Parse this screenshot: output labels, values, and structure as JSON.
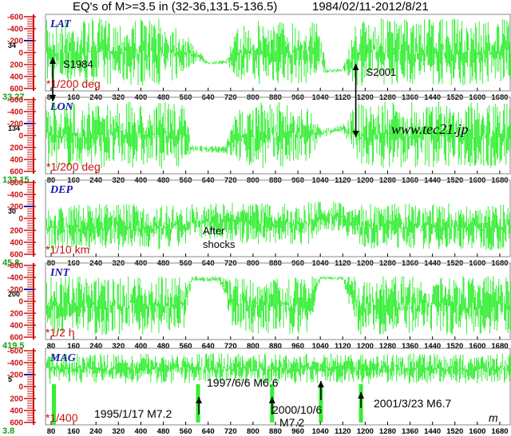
{
  "title": {
    "text": "EQ's of M>=3.5 in (32-36,131.5-136.5)",
    "date_range": "1984/02/11-2012/8/21"
  },
  "watermark": "www.tec21.jp",
  "colors": {
    "series": "#33ee33",
    "axis": "#cc1111",
    "zero_ref": "#1a1aa6",
    "text": "#000000",
    "offset_label": "#16a016"
  },
  "chart_data": {
    "type": "line",
    "x_axis": {
      "range": [
        60,
        1720
      ],
      "ticks": [
        80,
        160,
        240,
        320,
        400,
        480,
        560,
        640,
        720,
        800,
        880,
        960,
        1040,
        1120,
        1200,
        1280,
        1360,
        1440,
        1520,
        1600,
        1680
      ],
      "tick_labels": [
        "80",
        "160",
        "240",
        "320",
        "400",
        "480",
        "560",
        "640",
        "720",
        "800",
        "880",
        "960",
        "1040",
        "1120",
        "1200",
        "1280",
        "1360",
        "1440",
        "1520",
        "1600",
        "1680"
      ],
      "unit": "m"
    },
    "grid": false,
    "panels": [
      {
        "name": "LAT",
        "scale": "*1/200 deg",
        "ref_value": "34",
        "offset_value": "33.27",
        "ylim": [
          -600,
          600
        ],
        "yticks": [
          -600,
          -400,
          -200,
          0,
          200,
          400,
          600
        ],
        "envelope": [
          [
            80,
            -540,
            560
          ],
          [
            120,
            -560,
            540
          ],
          [
            200,
            -580,
            560
          ],
          [
            300,
            -560,
            540
          ],
          [
            400,
            -580,
            560
          ],
          [
            480,
            -560,
            540
          ],
          [
            540,
            -520,
            480
          ],
          [
            560,
            -300,
            300
          ],
          [
            600,
            -80,
            150
          ],
          [
            640,
            140,
            200
          ],
          [
            700,
            130,
            190
          ],
          [
            740,
            -380,
            420
          ],
          [
            800,
            -560,
            540
          ],
          [
            900,
            -560,
            540
          ],
          [
            1000,
            -540,
            520
          ],
          [
            1040,
            -520,
            500
          ],
          [
            1060,
            280,
            340
          ],
          [
            1120,
            260,
            320
          ],
          [
            1170,
            -560,
            560
          ],
          [
            1240,
            -580,
            540
          ],
          [
            1340,
            -560,
            540
          ],
          [
            1440,
            -560,
            540
          ],
          [
            1540,
            -580,
            560
          ],
          [
            1640,
            -560,
            540
          ],
          [
            1720,
            -560,
            540
          ]
        ]
      },
      {
        "name": "LON",
        "scale": "*1/200 deg",
        "ref_value": "134",
        "offset_value": "132.15",
        "ylim": [
          -600,
          600
        ],
        "yticks": [
          -600,
          -400,
          -200,
          0,
          200,
          400,
          600
        ],
        "envelope": [
          [
            80,
            -560,
            560
          ],
          [
            200,
            -560,
            540
          ],
          [
            300,
            -580,
            560
          ],
          [
            400,
            -560,
            540
          ],
          [
            500,
            -560,
            560
          ],
          [
            560,
            -500,
            480
          ],
          [
            580,
            160,
            280
          ],
          [
            700,
            180,
            300
          ],
          [
            740,
            -420,
            460
          ],
          [
            800,
            -560,
            560
          ],
          [
            900,
            -560,
            540
          ],
          [
            1000,
            -540,
            520
          ],
          [
            1040,
            -120,
            60
          ],
          [
            1120,
            -180,
            -80
          ],
          [
            1170,
            -540,
            560
          ],
          [
            1240,
            -560,
            540
          ],
          [
            1340,
            -560,
            560
          ],
          [
            1440,
            -580,
            540
          ],
          [
            1540,
            -560,
            540
          ],
          [
            1640,
            -560,
            560
          ],
          [
            1720,
            -540,
            540
          ]
        ]
      },
      {
        "name": "DEP",
        "scale": "*1/10 km",
        "ref_value": "30",
        "offset_value": "45.8",
        "ylim": [
          -600,
          600
        ],
        "yticks": [
          -600,
          -400,
          -200,
          0,
          200,
          400,
          600
        ],
        "envelope": [
          [
            80,
            -220,
            560
          ],
          [
            200,
            -240,
            520
          ],
          [
            300,
            -260,
            540
          ],
          [
            400,
            -240,
            560
          ],
          [
            500,
            -220,
            540
          ],
          [
            560,
            -240,
            460
          ],
          [
            600,
            -240,
            320
          ],
          [
            700,
            -260,
            380
          ],
          [
            800,
            -260,
            460
          ],
          [
            900,
            -260,
            420
          ],
          [
            1000,
            -280,
            440
          ],
          [
            1040,
            -300,
            200
          ],
          [
            1120,
            -300,
            220
          ],
          [
            1170,
            -260,
            480
          ],
          [
            1240,
            -240,
            520
          ],
          [
            1340,
            -260,
            500
          ],
          [
            1440,
            -240,
            520
          ],
          [
            1540,
            -260,
            520
          ],
          [
            1640,
            -240,
            540
          ],
          [
            1720,
            -260,
            520
          ]
        ]
      },
      {
        "name": "INT",
        "scale": "*1/2 h",
        "ref_value": "200",
        "offset_value": "419.5",
        "ylim": [
          -600,
          600
        ],
        "yticks": [
          -600,
          -400,
          -200,
          0,
          200,
          400,
          600
        ],
        "envelope": [
          [
            80,
            -420,
            560
          ],
          [
            200,
            -420,
            560
          ],
          [
            300,
            -420,
            560
          ],
          [
            400,
            -420,
            560
          ],
          [
            500,
            -420,
            560
          ],
          [
            560,
            -420,
            480
          ],
          [
            580,
            -420,
            -320
          ],
          [
            680,
            -420,
            -320
          ],
          [
            720,
            -420,
            400
          ],
          [
            800,
            -420,
            560
          ],
          [
            900,
            -420,
            560
          ],
          [
            1000,
            -420,
            560
          ],
          [
            1040,
            -420,
            -360
          ],
          [
            1120,
            -420,
            -360
          ],
          [
            1170,
            -420,
            560
          ],
          [
            1240,
            -420,
            560
          ],
          [
            1340,
            -420,
            560
          ],
          [
            1440,
            -420,
            560
          ],
          [
            1540,
            -420,
            560
          ],
          [
            1640,
            -420,
            560
          ],
          [
            1720,
            -420,
            560
          ]
        ]
      },
      {
        "name": "MAG",
        "scale": "*1/400",
        "ref_value": "5",
        "offset_value": "3.8",
        "ylim": [
          -600,
          600
        ],
        "yticks": [
          -600,
          -400,
          -200,
          0,
          200,
          400,
          600
        ],
        "envelope": [
          [
            80,
            -560,
            -40
          ],
          [
            200,
            -560,
            -60
          ],
          [
            300,
            -540,
            -40
          ],
          [
            400,
            -560,
            -60
          ],
          [
            500,
            -540,
            -40
          ],
          [
            600,
            -560,
            -60
          ],
          [
            700,
            -560,
            -60
          ],
          [
            800,
            -560,
            -40
          ],
          [
            900,
            -540,
            -60
          ],
          [
            1000,
            -560,
            -40
          ],
          [
            1100,
            -560,
            -60
          ],
          [
            1200,
            -540,
            -40
          ],
          [
            1300,
            -560,
            -60
          ],
          [
            1400,
            -560,
            -40
          ],
          [
            1500,
            -540,
            -60
          ],
          [
            1600,
            -560,
            -40
          ],
          [
            1720,
            -560,
            -60
          ]
        ],
        "spikes": [
          [
            90,
            640
          ],
          [
            604,
            600
          ],
          [
            868,
            600
          ],
          [
            1042,
            600
          ],
          [
            1185,
            600
          ]
        ]
      }
    ],
    "annotations": [
      {
        "id": "s1984",
        "text": "S1984",
        "x": 100
      },
      {
        "id": "s2001",
        "text": "S2001",
        "x": 1175
      },
      {
        "id": "aftershocks",
        "lines": [
          "After",
          "shocks"
        ],
        "x": 604
      }
    ],
    "events": [
      {
        "label": "1995/1/17 M7.2",
        "x": 604
      },
      {
        "label": "1997/6/6 M6.6",
        "x": 868
      },
      {
        "label_lines": [
          "2000/10/6",
          "M7.2"
        ],
        "x": 1042
      },
      {
        "label": "2001/3/23 M6.7",
        "x": 1185
      }
    ]
  }
}
